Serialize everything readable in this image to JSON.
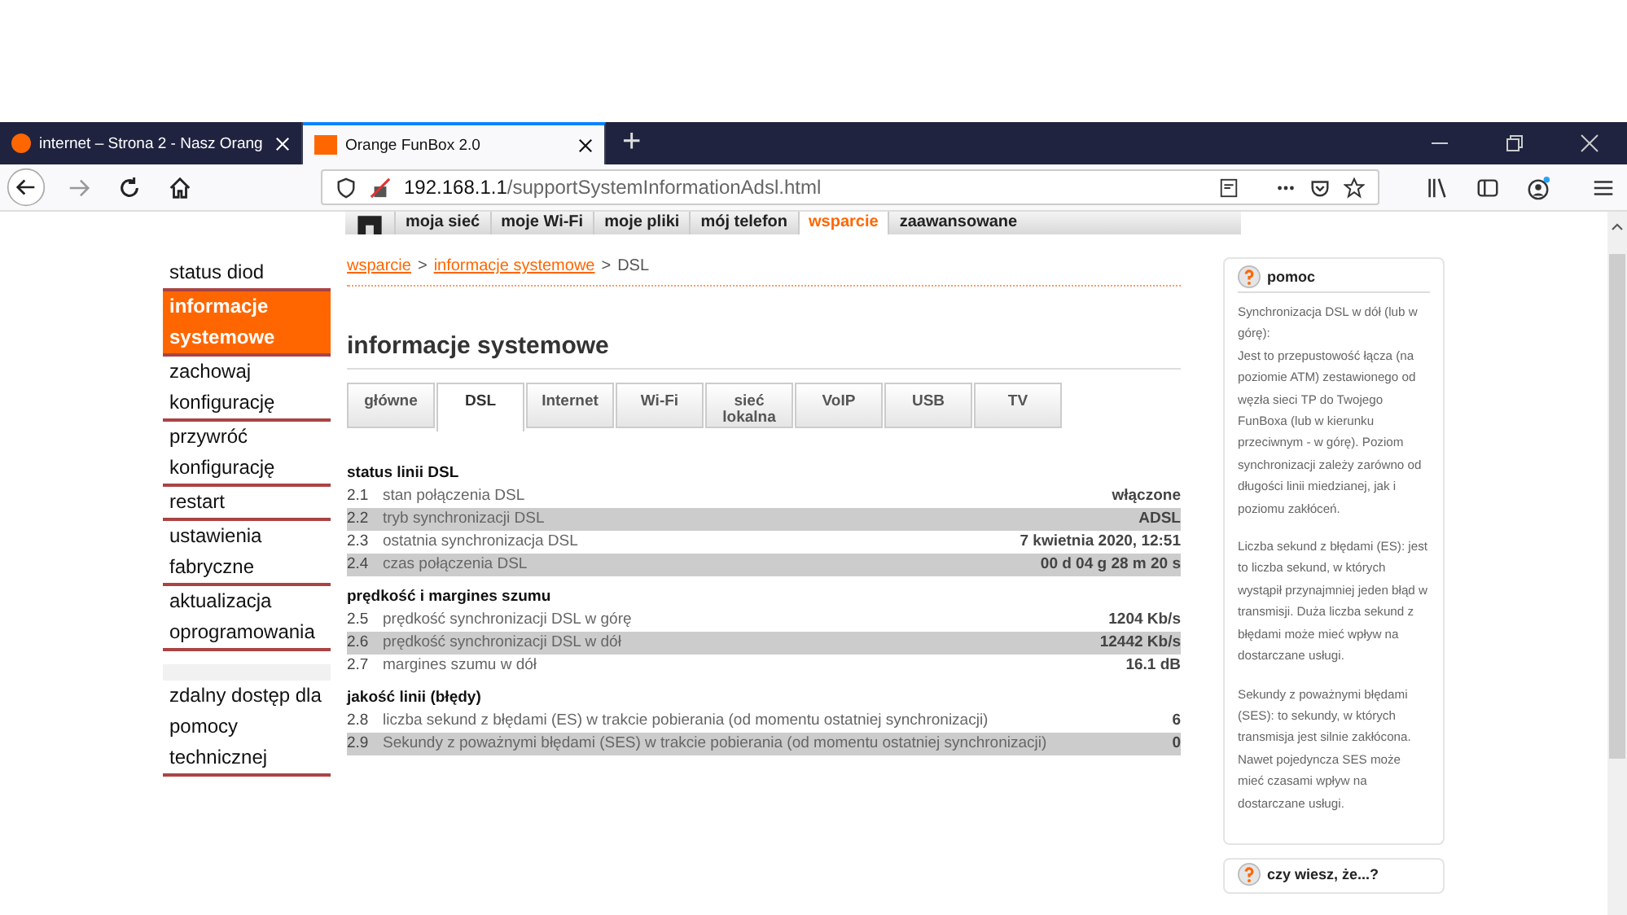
{
  "browser": {
    "tabs": [
      {
        "title": "internet – Strona 2 - Nasz Orang",
        "selected": false
      },
      {
        "title": "Orange FunBox 2.0",
        "selected": true
      }
    ],
    "new_tab": "+",
    "url_host": "192.168.1.1",
    "url_path": "/supportSystemInformationAdsl.html"
  },
  "top_nav": [
    {
      "label": "moja sieć",
      "selected": false
    },
    {
      "label": "moje Wi-Fi",
      "selected": false
    },
    {
      "label": "moje pliki",
      "selected": false
    },
    {
      "label": "mój telefon",
      "selected": false
    },
    {
      "label": "wsparcie",
      "selected": true
    },
    {
      "label": "zaawansowane",
      "selected": false
    }
  ],
  "sidebar": {
    "groups": [
      [
        {
          "label": "status diod",
          "selected": false
        },
        {
          "label": "informacje systemowe",
          "selected": true
        },
        {
          "label": "zachowaj konfigurację",
          "selected": false
        },
        {
          "label": "przywróć konfigurację",
          "selected": false
        },
        {
          "label": "restart",
          "selected": false
        },
        {
          "label": "ustawienia fabryczne",
          "selected": false
        },
        {
          "label": "aktualizacja oprogramowania",
          "selected": false
        }
      ],
      [
        {
          "label": "zdalny dostęp dla pomocy technicznej",
          "selected": false
        }
      ]
    ]
  },
  "breadcrumb": {
    "items": [
      "wsparcie",
      "informacje systemowe",
      "DSL"
    ],
    "separator": ">"
  },
  "heading": "informacje systemowe",
  "tabs": [
    {
      "label": "główne",
      "selected": false
    },
    {
      "label": "DSL",
      "selected": true
    },
    {
      "label": "Internet",
      "selected": false
    },
    {
      "label": "Wi-Fi",
      "selected": false
    },
    {
      "label": "sieć lokalna",
      "selected": false
    },
    {
      "label": "VoIP",
      "selected": false
    },
    {
      "label": "USB",
      "selected": false
    },
    {
      "label": "TV",
      "selected": false
    }
  ],
  "sections": [
    {
      "title": "status linii DSL",
      "rows": [
        {
          "num": "2.1",
          "label": "stan połączenia DSL",
          "value": "włączone"
        },
        {
          "num": "2.2",
          "label": "tryb synchronizacji DSL",
          "value": "ADSL"
        },
        {
          "num": "2.3",
          "label": "ostatnia synchronizacja DSL",
          "value": "7 kwietnia 2020, 12:51"
        },
        {
          "num": "2.4",
          "label": "czas połączenia DSL",
          "value": "00 d 04 g 28 m 20 s"
        }
      ]
    },
    {
      "title": "prędkość i margines szumu",
      "rows": [
        {
          "num": "2.5",
          "label": "prędkość synchronizacji DSL w górę",
          "value": "1204 Kb/s"
        },
        {
          "num": "2.6",
          "label": "prędkość synchronizacji DSL w dół",
          "value": "12442 Kb/s"
        },
        {
          "num": "2.7",
          "label": "margines szumu w dół",
          "value": "16.1 dB"
        }
      ]
    },
    {
      "title": "jakość linii (błędy)",
      "rows": [
        {
          "num": "2.8",
          "label": "liczba sekund z błędami (ES) w trakcie pobierania (od momentu ostatniej synchronizacji)",
          "value": "6"
        },
        {
          "num": "2.9",
          "label": "Sekundy z poważnymi błędami (SES) w trakcie pobierania (od momentu ostatniej synchronizacji)",
          "value": "0"
        }
      ]
    }
  ],
  "help": {
    "title": "pomoc",
    "paragraphs": [
      "Synchronizacja DSL w dół (lub w górę):",
      "Jest to przepustowość łącza (na poziomie ATM) zestawionego od węzła sieci TP do Twojego FunBoxa (lub w kierunku przeciwnym - w górę). Poziom synchronizacji zależy zarówno od długości linii miedzianej, jak i poziomu zakłóceń.",
      "Liczba sekund z błędami (ES): jest to liczba sekund, w których wystąpił przynajmniej jeden błąd w transmisji. Duża liczba sekund z błędami może mieć wpływ na dostarczane usługi.",
      "Sekundy z poważnymi błędami (SES): to sekundy, w których transmisja jest silnie zakłócona. Nawet pojedyncza SES może mieć czasami wpływ na dostarczane usługi."
    ],
    "next_title": "czy wiesz, że...?"
  }
}
